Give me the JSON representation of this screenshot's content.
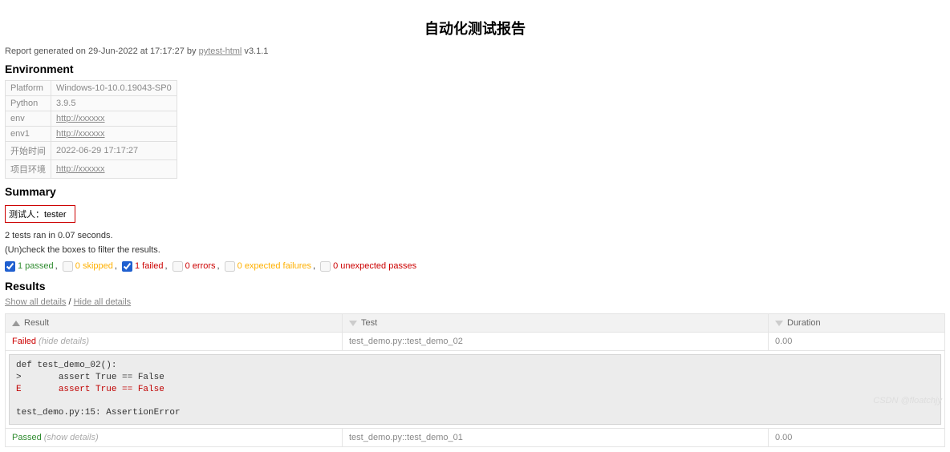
{
  "title": "自动化测试报告",
  "generated": {
    "prefix": "Report generated on ",
    "datetime": "29-Jun-2022 at 17:17:27",
    "by": " by ",
    "tool": "pytest-html",
    "version_prefix": " v",
    "version": "3.1.1"
  },
  "sections": {
    "environment": "Environment",
    "summary": "Summary",
    "results": "Results"
  },
  "environment": [
    {
      "key": "Platform",
      "value": "Windows-10-10.0.19043-SP0",
      "link": false
    },
    {
      "key": "Python",
      "value": "3.9.5",
      "link": false
    },
    {
      "key": "env",
      "value": "http://xxxxxx",
      "link": true
    },
    {
      "key": "env1",
      "value": "http://xxxxxx",
      "link": true
    },
    {
      "key": "开始时间",
      "value": "2022-06-29 17:17:27",
      "link": false
    },
    {
      "key": "项目环境",
      "value": "http://xxxxxx",
      "link": true
    }
  ],
  "summary": {
    "tester_label": "测试人：tester",
    "tests_ran": "2 tests ran in 0.07 seconds.",
    "filter_hint": "(Un)check the boxes to filter the results."
  },
  "filters": {
    "passed": "1 passed",
    "skipped": "0 skipped",
    "failed": "1 failed",
    "errors": "0 errors",
    "xfail": "0 expected failures",
    "xpass": "0 unexpected passes",
    "comma": ","
  },
  "details_toggles": {
    "show_all": "Show all details",
    "hide_all": "Hide all details",
    "sep": " / "
  },
  "table": {
    "headers": {
      "result": "Result",
      "test": "Test",
      "duration": "Duration"
    },
    "rows": [
      {
        "result": "Failed",
        "details_label": "(hide details)",
        "test": "test_demo.py::test_demo_02",
        "duration": "0.00",
        "expanded": true
      },
      {
        "result": "Passed",
        "details_label": "(show details)",
        "test": "test_demo.py::test_demo_01",
        "duration": "0.00",
        "expanded": false
      }
    ]
  },
  "traceback": {
    "line1": "def test_demo_02():",
    "line2_prefix": ">       ",
    "line2": "assert True == False",
    "line3_prefix": "E       ",
    "line3": "assert True == False",
    "blank": "",
    "line4": "test_demo.py:15: AssertionError"
  },
  "watermark": "CSDN @floatchjy"
}
